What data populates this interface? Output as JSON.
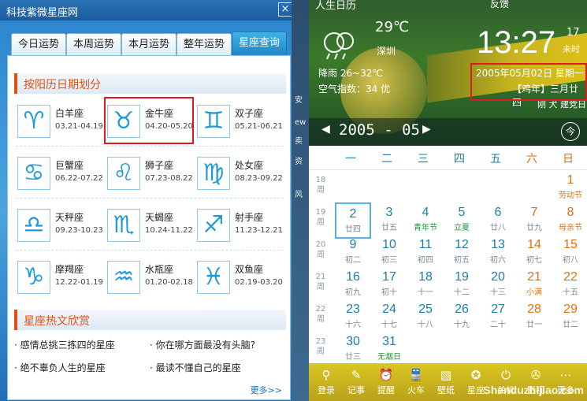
{
  "left_window": {
    "title": "科技紫微星座网",
    "close": "×",
    "tabs": [
      "今日运势",
      "本周运势",
      "本月运势",
      "整年运势",
      "星座查询"
    ],
    "section1_title": "按阳历日期划分",
    "zodiacs": [
      {
        "name": "白羊座",
        "dates": "03.21-04.19",
        "glyph": "♈"
      },
      {
        "name": "金牛座",
        "dates": "04.20-05.20",
        "glyph": "♉"
      },
      {
        "name": "双子座",
        "dates": "05.21-06.21",
        "glyph": "♊"
      },
      {
        "name": "巨蟹座",
        "dates": "06.22-07.22",
        "glyph": "♋"
      },
      {
        "name": "狮子座",
        "dates": "07.23-08.22",
        "glyph": "♌"
      },
      {
        "name": "处女座",
        "dates": "08.23-09.22",
        "glyph": "♍"
      },
      {
        "name": "天秤座",
        "dates": "09.23-10.23",
        "glyph": "♎"
      },
      {
        "name": "天蝎座",
        "dates": "10.24-11.22",
        "glyph": "♏"
      },
      {
        "name": "射手座",
        "dates": "11.23-12.21",
        "glyph": "♐"
      },
      {
        "name": "摩羯座",
        "dates": "12.22-01.19",
        "glyph": "♑"
      },
      {
        "name": "水瓶座",
        "dates": "01.20-02.18",
        "glyph": "♒"
      },
      {
        "name": "双鱼座",
        "dates": "02.19-03.20",
        "glyph": "♓"
      }
    ],
    "section2_title": "星座热文欣赏",
    "articles": [
      "· 感情总挑三拣四的星座",
      "· 你在哪方面最没有头脑?",
      "· 绝不辜负人生的星座",
      "· 最读不懂自己的星座"
    ],
    "more": "更多>>"
  },
  "strip_text": [
    "ew",
    "安",
    "资",
    "风",
    "卖"
  ],
  "calendar": {
    "app_title": "人生日历",
    "top_right": "反馈",
    "temperature": "29℃",
    "city": "深圳",
    "rain": "降雨 26~32℃",
    "air": "空气指数：34 优",
    "time": "13:27",
    "seconds": "17",
    "status": "未时",
    "date_line": "2005年05月02日 星期一",
    "lunar_line": "【鸡年】三月廿四",
    "extra": "刚 犬 建党日",
    "year_month": "2005 - 05",
    "today_btn": "今",
    "weekdays": [
      "一",
      "二",
      "三",
      "四",
      "五",
      "六",
      "日"
    ],
    "weeks": [
      {
        "no": "18",
        "days": [
          {
            "d": "",
            "l": ""
          },
          {
            "d": "",
            "l": ""
          },
          {
            "d": "",
            "l": ""
          },
          {
            "d": "",
            "l": ""
          },
          {
            "d": "",
            "l": ""
          },
          {
            "d": "",
            "l": ""
          },
          {
            "d": "1",
            "l": "劳动节",
            "fest": true
          }
        ]
      },
      {
        "no": "19",
        "days": [
          {
            "d": "2",
            "l": "廿四",
            "sel": true
          },
          {
            "d": "3",
            "l": "廿五"
          },
          {
            "d": "4",
            "l": "青年节",
            "fest": true
          },
          {
            "d": "5",
            "l": "立夏",
            "fest": true
          },
          {
            "d": "6",
            "l": "廿八"
          },
          {
            "d": "7",
            "l": "廿九"
          },
          {
            "d": "8",
            "l": "母亲节",
            "fest": true
          }
        ]
      },
      {
        "no": "20",
        "days": [
          {
            "d": "9",
            "l": "初二"
          },
          {
            "d": "10",
            "l": "初三"
          },
          {
            "d": "11",
            "l": "初四"
          },
          {
            "d": "12",
            "l": "初五"
          },
          {
            "d": "13",
            "l": "初六"
          },
          {
            "d": "14",
            "l": "初七"
          },
          {
            "d": "15",
            "l": "初八"
          }
        ]
      },
      {
        "no": "21",
        "days": [
          {
            "d": "16",
            "l": "初九"
          },
          {
            "d": "17",
            "l": "初十"
          },
          {
            "d": "18",
            "l": "十一"
          },
          {
            "d": "19",
            "l": "十二"
          },
          {
            "d": "20",
            "l": "十三"
          },
          {
            "d": "21",
            "l": "小满",
            "fest": true
          },
          {
            "d": "22",
            "l": "十五"
          }
        ]
      },
      {
        "no": "22",
        "days": [
          {
            "d": "23",
            "l": "十六"
          },
          {
            "d": "24",
            "l": "十七"
          },
          {
            "d": "25",
            "l": "十八"
          },
          {
            "d": "26",
            "l": "十九"
          },
          {
            "d": "27",
            "l": "二十"
          },
          {
            "d": "28",
            "l": "廿一"
          },
          {
            "d": "29",
            "l": "廿二"
          }
        ]
      },
      {
        "no": "23",
        "days": [
          {
            "d": "30",
            "l": "廿三"
          },
          {
            "d": "31",
            "l": "无烟日",
            "fest": true
          },
          {
            "d": "",
            "l": ""
          },
          {
            "d": "",
            "l": ""
          },
          {
            "d": "",
            "l": ""
          },
          {
            "d": "",
            "l": ""
          },
          {
            "d": "",
            "l": ""
          }
        ]
      }
    ],
    "week_label": "周",
    "bottom_buttons": [
      {
        "label": "登录",
        "icon": "⚲"
      },
      {
        "label": "记事",
        "icon": "✎"
      },
      {
        "label": "提醒",
        "icon": "⏰"
      },
      {
        "label": "火车",
        "icon": "🚆"
      },
      {
        "label": "壁纸",
        "icon": "▧"
      },
      {
        "label": "星座",
        "icon": "✪"
      },
      {
        "label": "关机",
        "icon": "⏻"
      },
      {
        "label": "影视",
        "icon": "✇"
      },
      {
        "label": "更多",
        "icon": "⋯"
      }
    ],
    "watermark": "Shenduzhijiao.com"
  }
}
